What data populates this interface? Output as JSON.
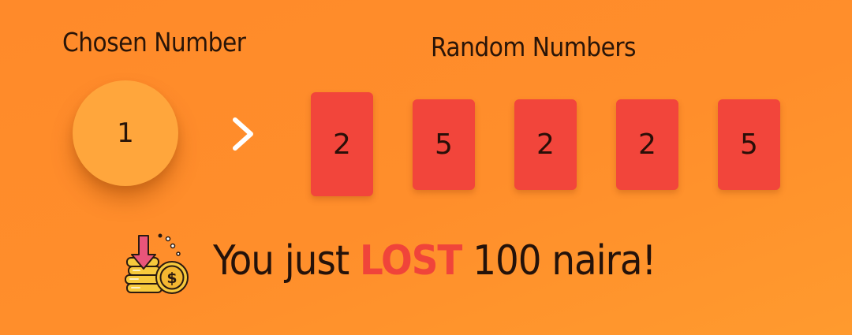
{
  "labels": {
    "chosen_title": "Chosen Number",
    "random_title": "Random Numbers"
  },
  "chosen_number": "1",
  "random_numbers": [
    "2",
    "5",
    "2",
    "2",
    "5"
  ],
  "result": {
    "prefix": "You just",
    "outcome": "LOST",
    "suffix": "100 naira!"
  },
  "colors": {
    "background": "#ff8e2b",
    "circle": "#ffa63c",
    "card": "#f2453b",
    "lost_text": "#f0443a",
    "text_dark": "#24120a"
  },
  "icons": {
    "arrow": "chevron-right-icon",
    "money": "money-loss-icon"
  }
}
